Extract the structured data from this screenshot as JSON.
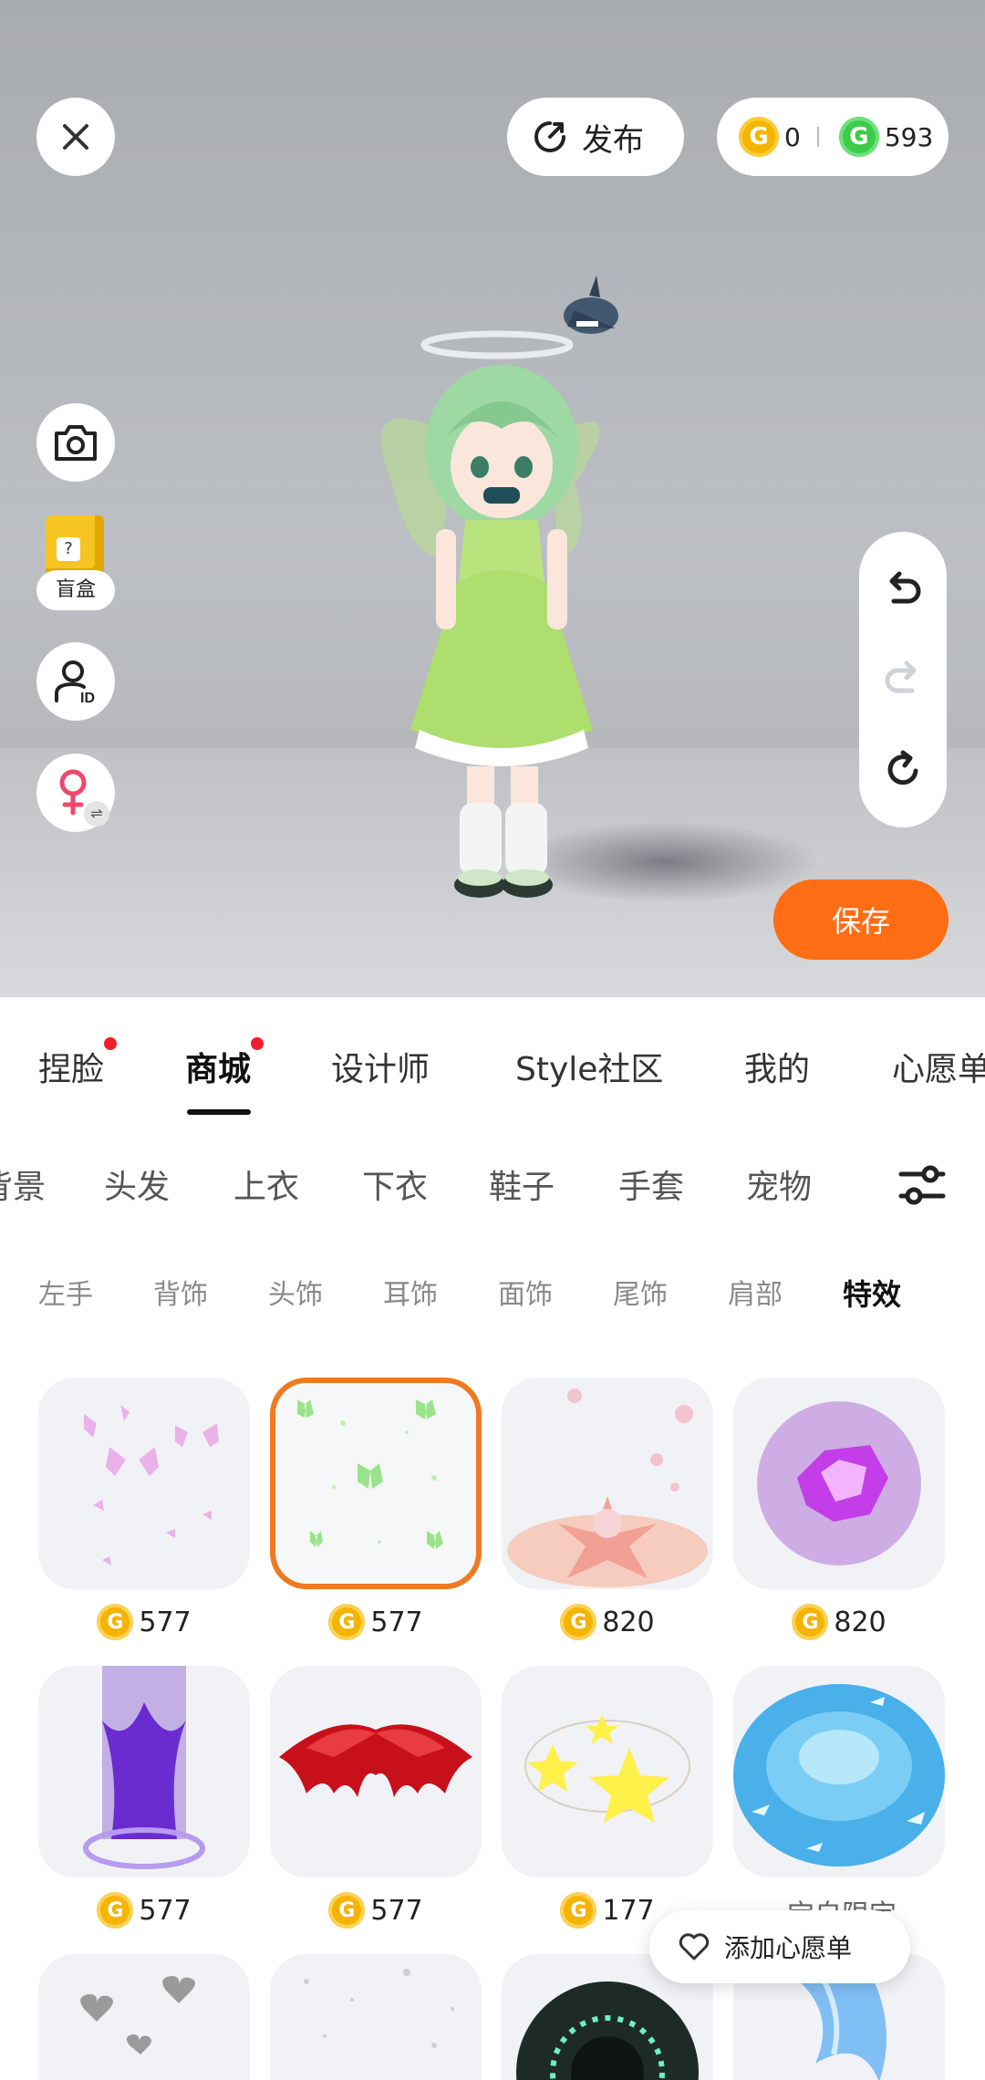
{
  "topbar": {
    "publish_label": "发布",
    "wallet": {
      "gold_amount": "0",
      "green_amount": "593"
    }
  },
  "side": {
    "blindbox_label": "盲盒"
  },
  "save_label": "保存",
  "main_tabs": [
    {
      "label": "捏脸",
      "badge": true
    },
    {
      "label": "商城",
      "badge": true,
      "active": true
    },
    {
      "label": "设计师",
      "badge": false
    },
    {
      "label": "Style社区",
      "badge": false
    },
    {
      "label": "我的",
      "badge": false
    },
    {
      "label": "心愿单",
      "badge": false
    }
  ],
  "categories": [
    "背景",
    "头发",
    "上衣",
    "下衣",
    "鞋子",
    "手套",
    "宠物"
  ],
  "subcategories": [
    "左手",
    "背饰",
    "头饰",
    "耳饰",
    "面饰",
    "尾饰",
    "肩部",
    "特效"
  ],
  "active_subcategory": "特效",
  "items": [
    {
      "price": "577",
      "icon": "pink-butterflies-effect"
    },
    {
      "price": "577",
      "icon": "green-butterflies-effect",
      "selected": true
    },
    {
      "price": "820",
      "icon": "pink-flower-burst-effect"
    },
    {
      "price": "820",
      "icon": "purple-energy-effect"
    },
    {
      "price": "577",
      "icon": "purple-flame-pillar-effect"
    },
    {
      "price": "577",
      "icon": "red-bat-wings-effect"
    },
    {
      "price": "177",
      "icon": "yellow-stars-effect"
    },
    {
      "price": "",
      "icon": "blue-water-ripple-effect",
      "partial_label": "宝自限定"
    },
    {
      "price": "",
      "icon": "silver-hearts-effect"
    },
    {
      "price": "",
      "icon": "sparkle-dust-effect"
    },
    {
      "price": "",
      "icon": "dark-portal-effect"
    },
    {
      "price": "",
      "icon": "blue-wave-effect"
    }
  ],
  "wishlist_button_label": "添加心愿单",
  "colors": {
    "accent_orange": "#ff6d14",
    "badge_red": "#f0202a",
    "coin_gold": "#f5b400",
    "coin_green": "#3ecb4a"
  }
}
